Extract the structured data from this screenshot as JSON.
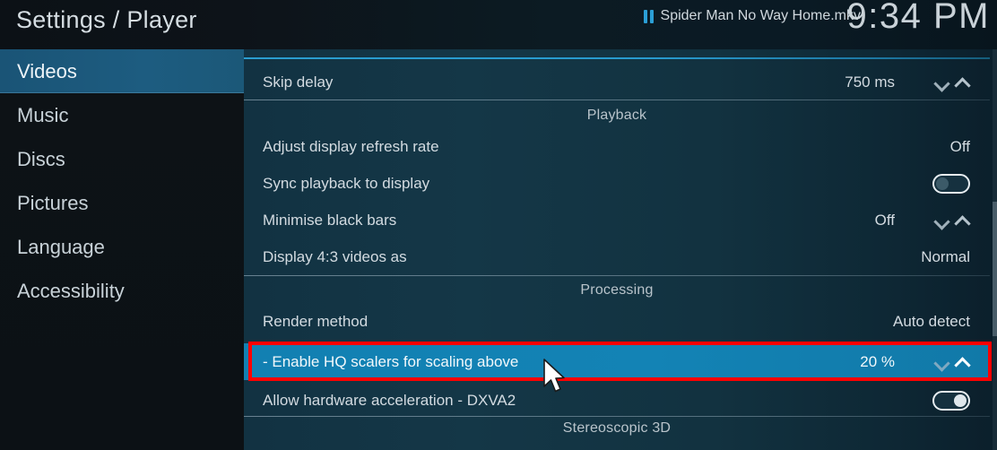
{
  "header": {
    "title": "Settings / Player",
    "now_playing": {
      "icon": "pause-icon",
      "title": "Spider Man No Way Home.mkv"
    },
    "clock": "9:34 PM"
  },
  "sidebar": {
    "items": [
      {
        "label": "Videos",
        "selected": true
      },
      {
        "label": "Music",
        "selected": false
      },
      {
        "label": "Discs",
        "selected": false
      },
      {
        "label": "Pictures",
        "selected": false
      },
      {
        "label": "Language",
        "selected": false
      },
      {
        "label": "Accessibility",
        "selected": false
      }
    ]
  },
  "content": {
    "rows": {
      "skip_delay": {
        "label": "Skip delay",
        "value": "750 ms",
        "control": "spinner"
      },
      "adjust_refresh": {
        "label": "Adjust display refresh rate",
        "value": "Off",
        "control": "text"
      },
      "sync_playback": {
        "label": "Sync playback to display",
        "value": "Off",
        "control": "toggle-off"
      },
      "minimise_black_bars": {
        "label": "Minimise black bars",
        "value": "Off",
        "control": "spinner"
      },
      "display_43": {
        "label": "Display 4:3 videos as",
        "value": "Normal",
        "control": "text"
      },
      "render_method": {
        "label": "Render method",
        "value": "Auto detect",
        "control": "text"
      },
      "hq_scalers": {
        "label": "- Enable HQ scalers for scaling above",
        "value": "20 %",
        "control": "spinner",
        "selected": true
      },
      "hw_accel": {
        "label": "Allow hardware acceleration - DXVA2",
        "value": "On",
        "control": "toggle-on"
      }
    },
    "sections": {
      "playback": "Playback",
      "processing": "Processing",
      "stereoscopic": "Stereoscopic 3D"
    }
  },
  "annotation": {
    "color": "#fe0000",
    "target": "hq_scalers"
  },
  "colors": {
    "selection_blue": "#1280b2",
    "sidebar_selected": "#1d5c80",
    "accent_line": "#2ba3d8",
    "content_bg": "#123242",
    "annotation_red": "#fe0000"
  }
}
